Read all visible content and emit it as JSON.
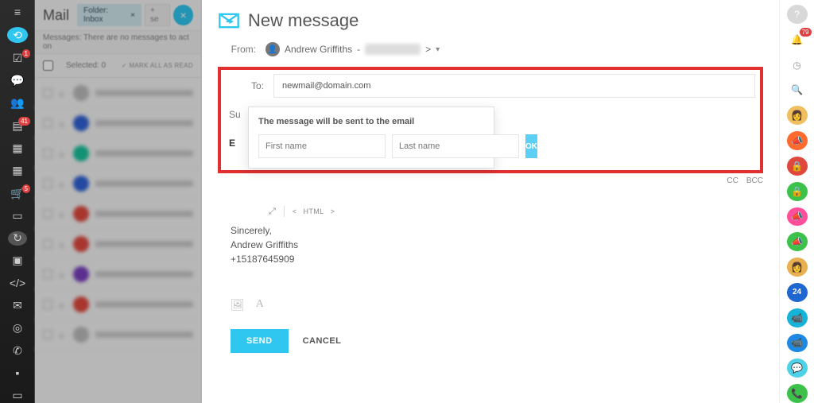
{
  "app": {
    "title": "Mail"
  },
  "folder": {
    "chip_label": "Folder: Inbox",
    "add": "+ se"
  },
  "statusbar": {
    "text": "Messages: There are no messages to act on"
  },
  "selection": {
    "selected": "Selected: 0",
    "mark_all": "MARK ALL AS READ"
  },
  "list_rows": [
    {
      "color": "#bdbdbd"
    },
    {
      "color": "#2f62d6"
    },
    {
      "color": "#18c29c"
    },
    {
      "color": "#2f62d6"
    },
    {
      "color": "#e0483e"
    },
    {
      "color": "#e0483e"
    },
    {
      "color": "#7a3fbf"
    },
    {
      "color": "#e0483e"
    },
    {
      "color": "#bdbdbd"
    }
  ],
  "compose": {
    "title": "New message",
    "from_label": "From:",
    "from_name": "Andrew Griffiths",
    "to_label": "To:",
    "to_value": "newmail@domain.com",
    "subject_label": "Su",
    "cc": "CC",
    "bcc": "BCC",
    "body_b": "E",
    "body_sign1": "Sincerely,",
    "body_sign2": "Andrew Griffiths",
    "body_sign3": "+15187645909",
    "html": "HTML",
    "send": "SEND",
    "cancel": "CANCEL"
  },
  "popover": {
    "title": "The message will be sent to the email",
    "first_ph": "First name",
    "last_ph": "Last name",
    "ok": "OK"
  },
  "right_rail": {
    "bell_badge": "79"
  }
}
